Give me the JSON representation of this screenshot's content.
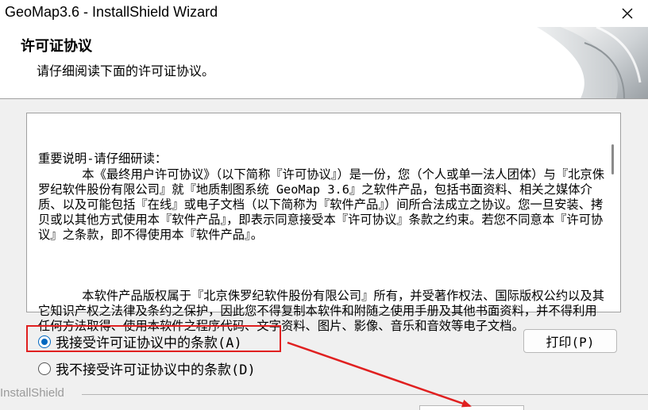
{
  "window": {
    "title": "GeoMap3.6 - InstallShield Wizard"
  },
  "header": {
    "title": "许可证协议",
    "subtitle": "请仔细阅读下面的许可证协议。"
  },
  "license": {
    "para1": "重要说明-请仔细研读：\n      本《最终用户许可协议》（以下简称『许可协议』）是一份，您（个人或单一法人团体）与『北京侏罗纪软件股份有限公司』就『地质制图系统 GeoMap 3.6』之软件产品，包括书面资料、相关之媒体介质、以及可能包括『在线』或电子文档（以下简称为『软件产品』）间所合法成立之协议。您一旦安装、拷贝或以其他方式使用本『软件产品』，即表示同意接受本『许可协议』条款之约束。若您不同意本『许可协议』之条款，即不得使用本『软件产品』。",
    "para2": "      本软件产品版权属于『北京侏罗纪软件股份有限公司』所有，并受著作权法、国际版权公约以及其它知识产权之法律及条约之保护，因此您不得复制本软件和附随之使用手册及其他书面资料，并不得利用任何方法取得、使用本软件之程序代码、文字资料、图片、影像、音乐和音效等电子文档。"
  },
  "options": {
    "accept_label": "我接受许可证协议中的条款(A)",
    "decline_label": "我不接受许可证协议中的条款(D)",
    "selected": "accept"
  },
  "buttons": {
    "print_label": "打印(P)"
  },
  "footer": {
    "brand": "InstallShield"
  },
  "colors": {
    "accent": "#0067c0",
    "annotation": "#e02020"
  },
  "icons": {
    "close": "close-icon"
  }
}
